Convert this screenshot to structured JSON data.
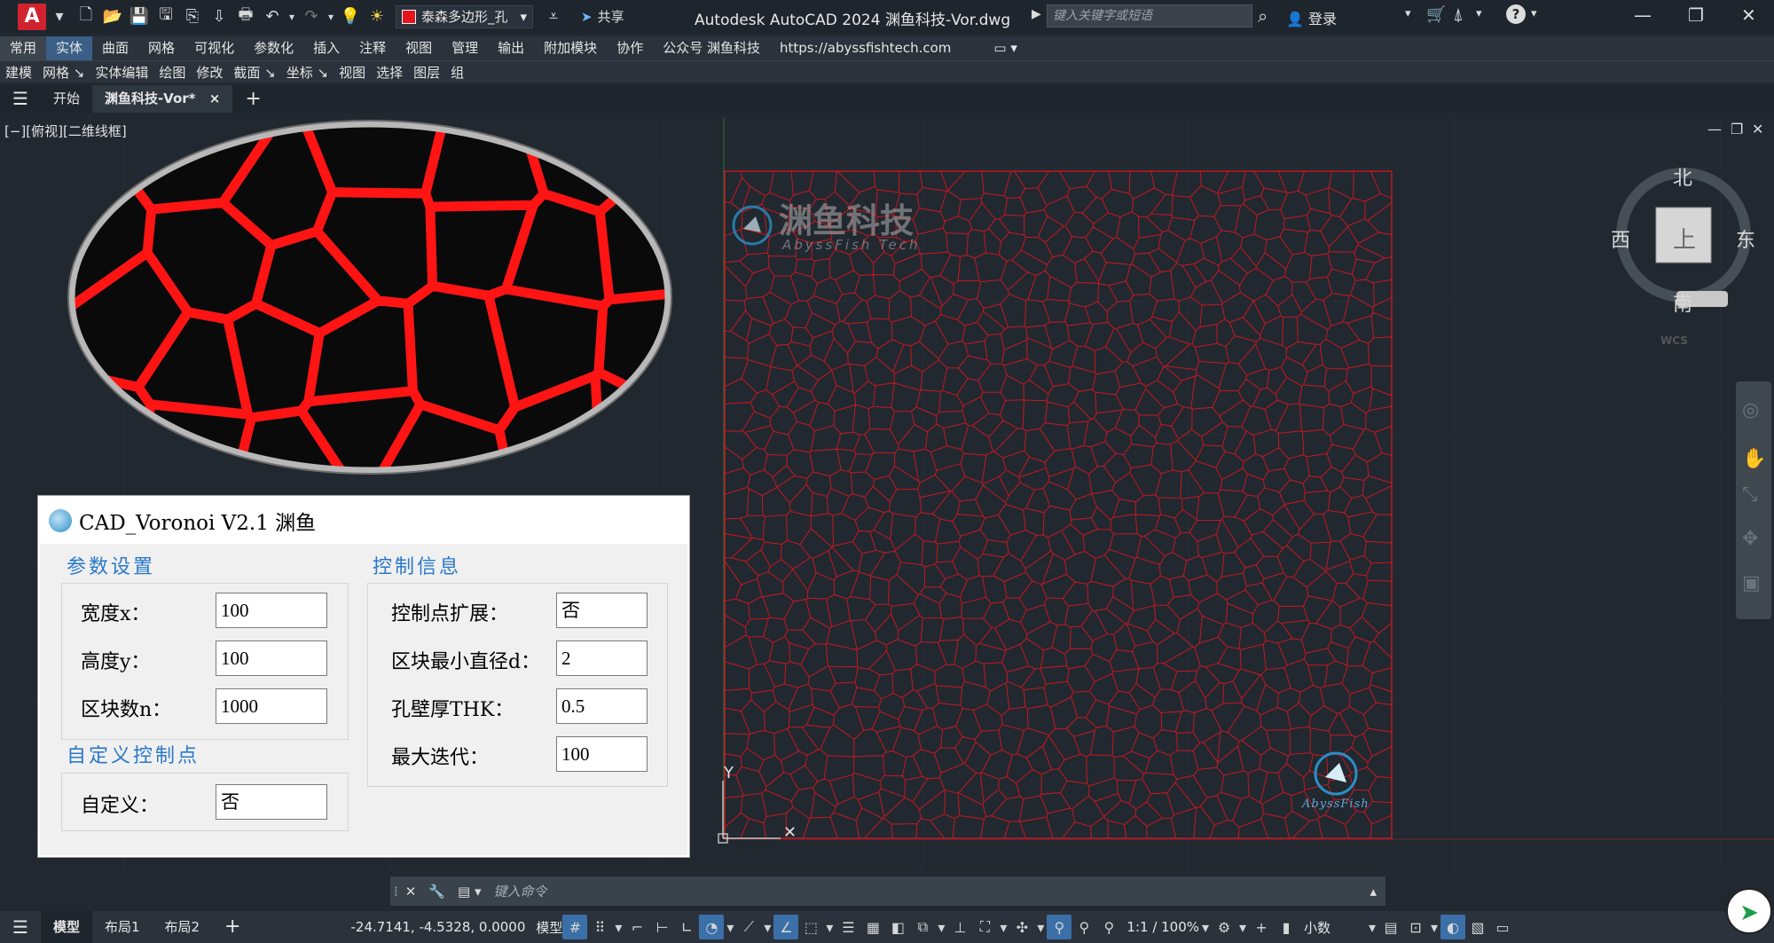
{
  "titlebar": {
    "app_logo": "A",
    "layer_name": "泰森多边形_孔",
    "share_label": "共享",
    "doc_title": "Autodesk AutoCAD 2024    渊鱼科技-Vor.dwg",
    "search_placeholder": "键入关键字或短语",
    "login_label": "登录"
  },
  "ribbon": {
    "tabs": [
      "常用",
      "实体",
      "曲面",
      "网格",
      "可视化",
      "参数化",
      "插入",
      "注释",
      "视图",
      "管理",
      "输出",
      "附加模块",
      "协作",
      "公众号 渊鱼科技",
      "https://abyssfishtech.com"
    ],
    "panels": [
      "建模",
      "网格 ↘",
      "实体编辑",
      "绘图",
      "修改",
      "截面 ↘",
      "坐标 ↘",
      "视图",
      "选择",
      "图层",
      "组"
    ]
  },
  "doctabs": {
    "start": "开始",
    "active": "渊鱼科技-Vor*",
    "close": "×",
    "add": "+"
  },
  "viewport": {
    "label": "[−][俯视][二维线框]"
  },
  "watermark": {
    "title": "渊鱼科技",
    "subtitle": "AbyssFish Tech",
    "corner_text": "AbyssFish"
  },
  "viewcube": {
    "north": "北",
    "south": "南",
    "east": "东",
    "west": "西",
    "face": "上",
    "wcs": "WCS"
  },
  "dialog": {
    "title": "CAD_Voronoi V2.1 渊鱼",
    "group_params": "参数设置",
    "group_control": "控制信息",
    "group_custom": "自定义控制点",
    "width_label": "宽度x：",
    "width_value": "100",
    "height_label": "高度y：",
    "height_value": "100",
    "blocks_label": "区块数n：",
    "blocks_value": "1000",
    "custom_label": "自定义：",
    "custom_value": "否",
    "expand_label": "控制点扩展：",
    "expand_value": "否",
    "mindia_label": "区块最小直径d：",
    "mindia_value": "2",
    "thk_label": "孔壁厚THK：",
    "thk_value": "0.5",
    "iter_label": "最大迭代：",
    "iter_value": "100"
  },
  "commandline": {
    "placeholder": "键入命令"
  },
  "statusbar": {
    "tabs": [
      "模型",
      "布局1",
      "布局2"
    ],
    "coords": "-24.7141, -4.5328, 0.0000",
    "model": "模型",
    "scale": "1:1 / 100%",
    "units": "小数"
  },
  "colors": {
    "voronoi_red": "#e3141c",
    "background": "#212830"
  }
}
